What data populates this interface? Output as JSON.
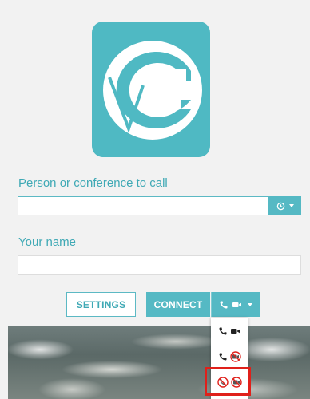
{
  "form": {
    "person_label": "Person or conference to call",
    "person_value": "",
    "name_label": "Your name",
    "name_value": ""
  },
  "buttons": {
    "settings_label": "SETTINGS",
    "connect_label": "CONNECT"
  },
  "media_options": [
    {
      "name": "audio-and-video"
    },
    {
      "name": "audio-only"
    },
    {
      "name": "no-audio-no-video"
    }
  ],
  "colors": {
    "accent": "#55b9c4",
    "label": "#3fa9b5",
    "highlight": "#e0201a"
  },
  "icons": {
    "logo": "vc-logo",
    "history": "history-icon",
    "phone": "phone-icon",
    "video": "video-camera-icon"
  }
}
